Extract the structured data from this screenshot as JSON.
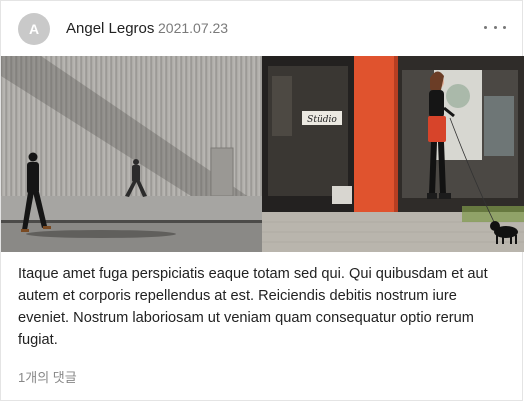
{
  "post": {
    "avatar_initial": "A",
    "author": "Angel Legros",
    "date": "2021.07.23",
    "more_icon": "more-horizontal-icon",
    "body": "Itaque amet fuga perspiciatis eaque totam sed qui. Qui quibusdam et aut autem et corporis repellendus at est. Reiciendis debitis nostrum iure eveniet. Nostrum laboriosam ut veniam quam consequatur optio rerum fugiat.",
    "comments_label": "1개의 댓글"
  },
  "images": [
    {
      "name": "photo-warehouse-walkers"
    },
    {
      "name": "photo-woman-walking-dog",
      "sign_text": "Stüdio"
    }
  ],
  "colors": {
    "avatar_bg": "#c9c9c9",
    "storefront_orange": "#e0532e"
  }
}
